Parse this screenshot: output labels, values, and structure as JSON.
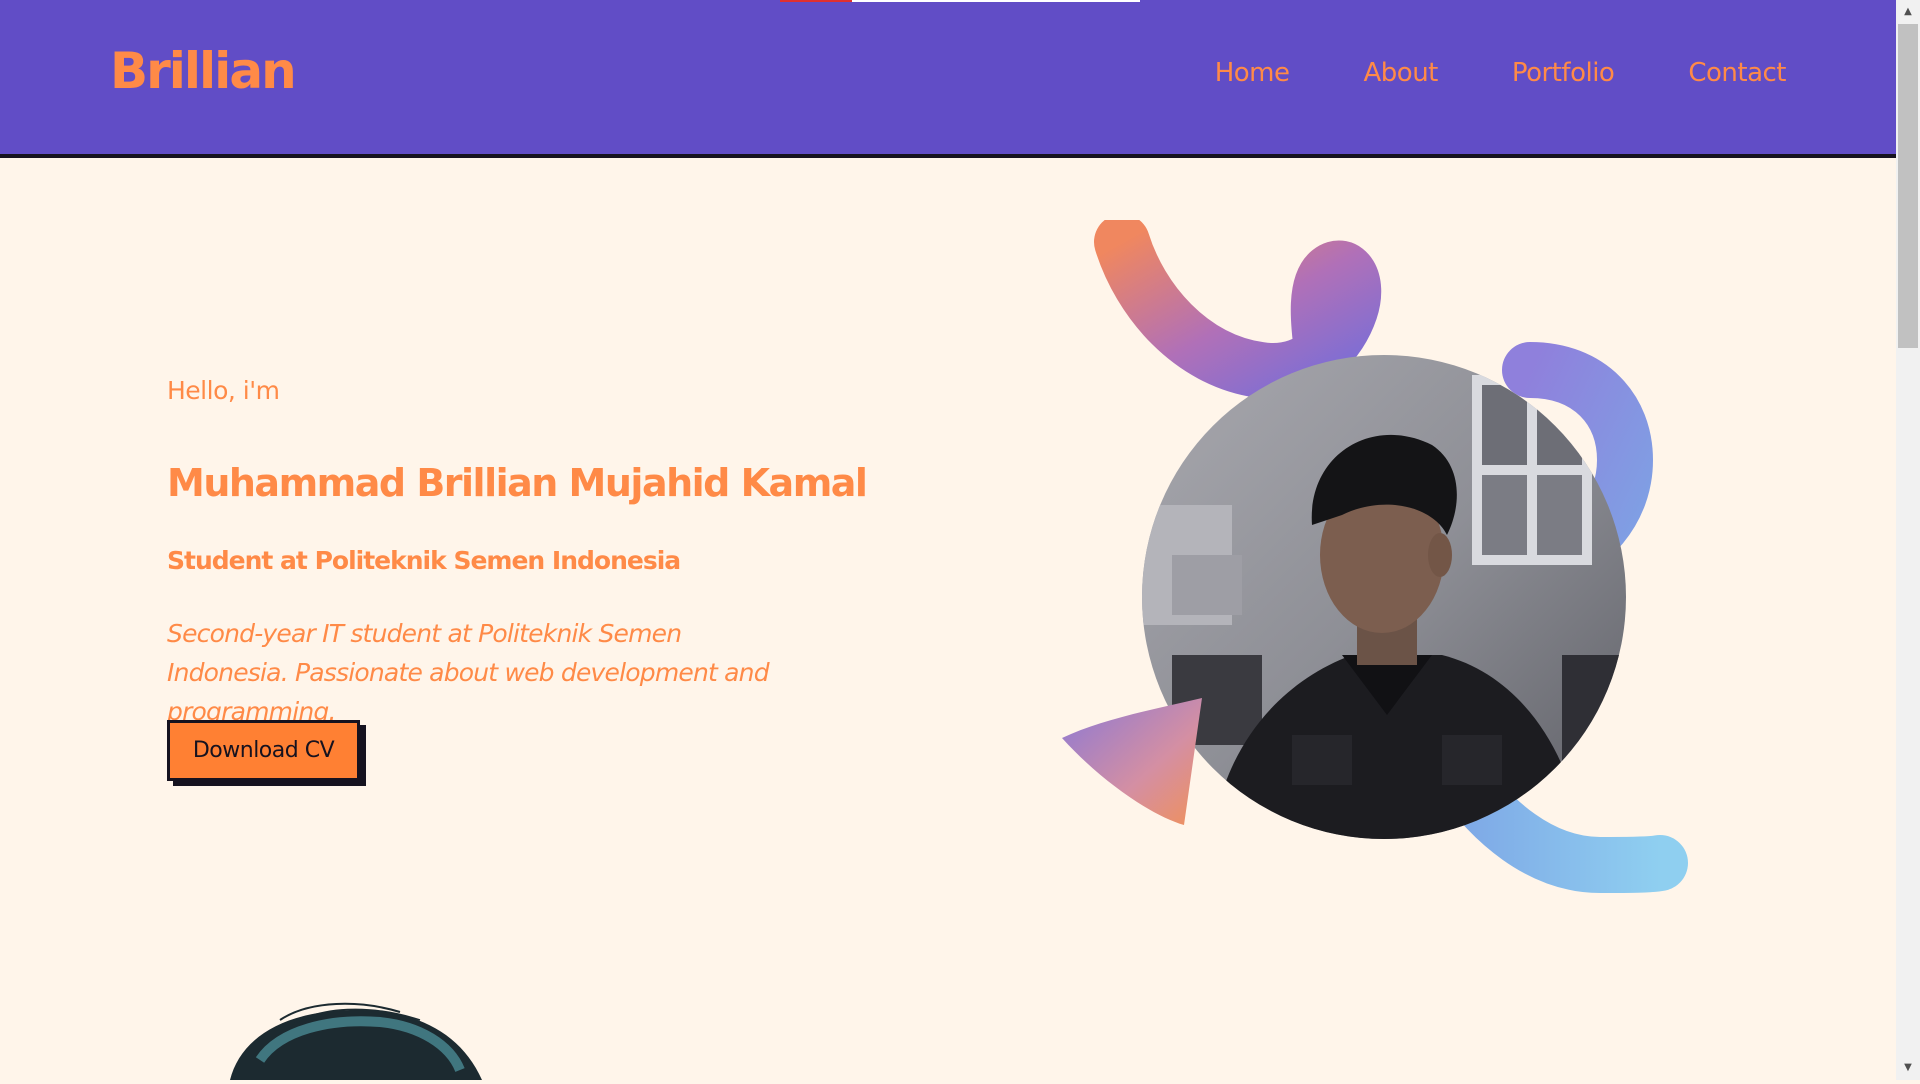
{
  "page": {
    "background": "#fff5ea",
    "accent": "#ff8a47",
    "nav_bg": "#614dc6",
    "progress_fraction": 0.2
  },
  "header": {
    "brand": "Brillian",
    "nav": [
      "Home",
      "About",
      "Portfolio",
      "Contact"
    ]
  },
  "hero": {
    "greeting": "Hello, i'm",
    "name": "Muhammad Brillian Mujahid Kamal",
    "role": "Student at Politeknik Semen Indonesia",
    "description": "Second-year IT student at Politeknik Semen Indonesia. Passionate about web development and programming.",
    "cta": "Download CV"
  },
  "icons": {
    "scroll_up": "arrow-up-icon",
    "scroll_down": "arrow-down-icon"
  }
}
